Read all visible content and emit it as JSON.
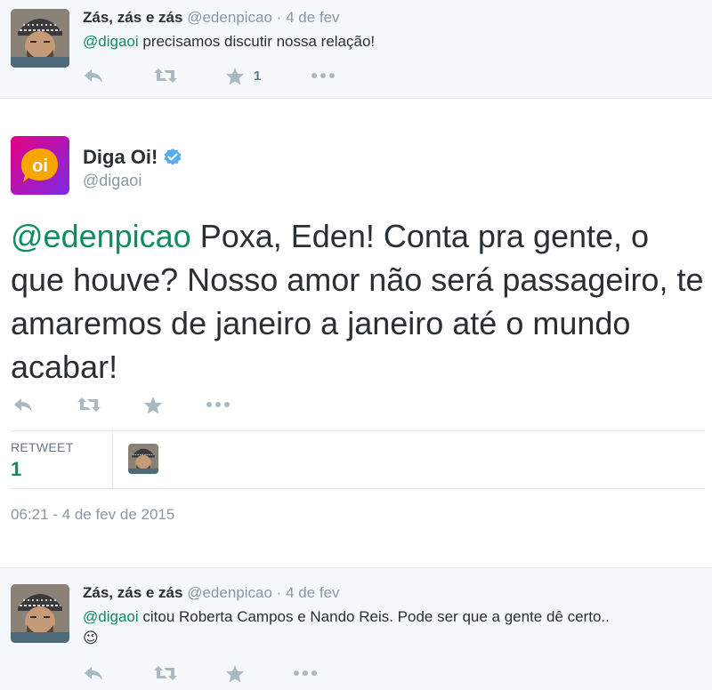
{
  "reply_top": {
    "name": "Zás, zás e zás",
    "handle": "@edenpicao",
    "separator": "·",
    "date": "4 de fev",
    "mention": "@digaoi",
    "text": " precisamos discutir nossa relação!",
    "favorite_count": "1"
  },
  "main_tweet": {
    "name": "Diga Oi!",
    "handle": "@digaoi",
    "avatar_text": "oi",
    "mention": "@edenpicao",
    "text": " Poxa, Eden! Conta pra gente, o que houve? Nosso amor não será passageiro, te amaremos de janeiro a janeiro até o mundo acabar!",
    "retweet_label": "RETWEET",
    "retweet_count": "1",
    "timestamp": "06:21 - 4 de fev de 2015"
  },
  "reply_bottom": {
    "name": "Zás, zás e zás",
    "handle": "@edenpicao",
    "separator": "·",
    "date": "4 de fev",
    "mention": "@digaoi",
    "text": " citou Roberta Campos e Nando Reis. Pode ser que a gente dê certo..",
    "emoji": "😉"
  },
  "colors": {
    "mention": "#0f8d5f",
    "muted": "#8899a6",
    "verified": "#55acee",
    "brand_gradient_start": "#e6007e",
    "brand_gradient_end": "#7d2ae8",
    "brand_bubble": "#f7a600"
  },
  "icons": [
    "reply-icon",
    "retweet-icon",
    "favorite-icon",
    "more-icon",
    "verified-icon"
  ]
}
